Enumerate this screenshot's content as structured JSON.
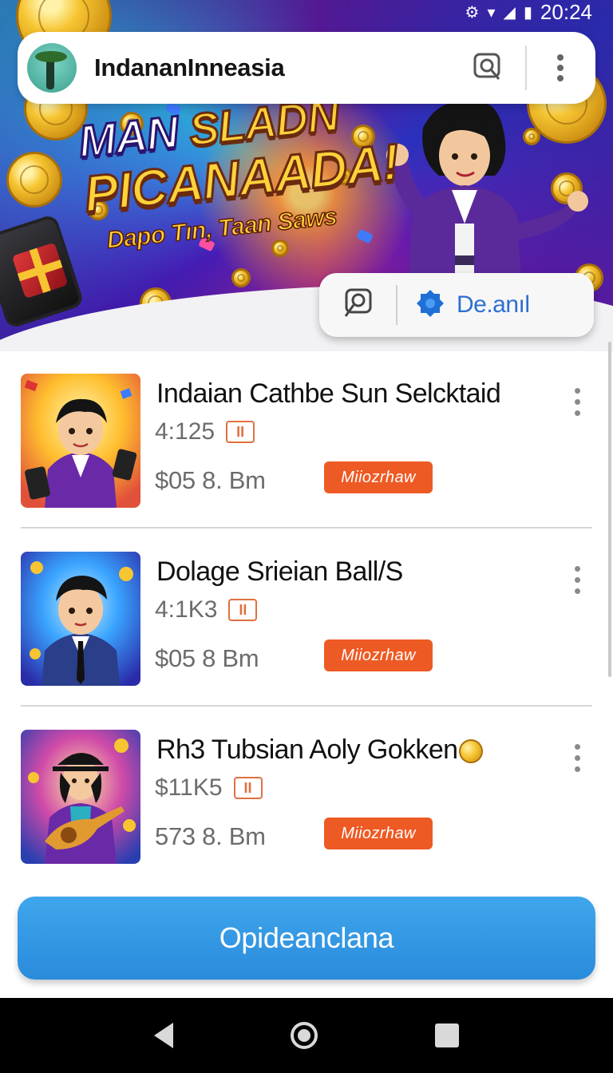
{
  "status_bar": {
    "time": "20:24"
  },
  "app_bar": {
    "title": "IndananInneasia",
    "search_icon": "search-icon",
    "more_icon": "more-vert-icon"
  },
  "hero": {
    "line1_a": "MAN",
    "line1_b": "SLADN",
    "line2": "PICANAADA!",
    "line3": "Dapo Tın, Taan Saws"
  },
  "action_pill": {
    "search_icon": "search-icon",
    "detail_icon": "gear-icon",
    "detail_label": "De.anıl"
  },
  "items": [
    {
      "name": "Indaian Cathbe Sun Selcktaid",
      "rating": "4:125",
      "chip": "II",
      "price": "$05 8. Bm",
      "badge": "Miiozrhaw"
    },
    {
      "name": "Dolage Srieian Ball/S",
      "rating": "4:1K3",
      "chip": "II",
      "price": "$05 8  Bm",
      "badge": "Miiozrhaw"
    },
    {
      "name": "Rh3 Tubsian Aoly Gokken",
      "rating": "$11K5",
      "chip": "II",
      "price": "573 8. Bm",
      "badge": "Miiozrhaw"
    }
  ],
  "cta": {
    "label": "Opideanclana"
  },
  "colors": {
    "accent_blue": "#2a8bdc",
    "badge_orange": "#ee5a24",
    "pill_blue": "#2d6fd1"
  }
}
